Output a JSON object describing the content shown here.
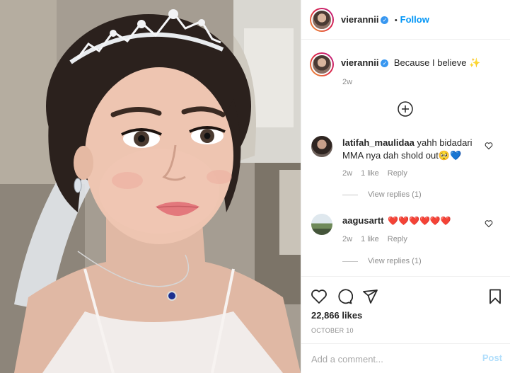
{
  "post": {
    "author": "vierannii",
    "follow_label": "Follow",
    "bullet": "•",
    "caption": "Because I believe ✨",
    "caption_age": "2w"
  },
  "comments": [
    {
      "username": "latifah_maulidaa",
      "text": "yahh bidadari MMA nya dah shold out🥺💙",
      "age": "2w",
      "likes": "1 like",
      "reply_label": "Reply",
      "view_replies": "View replies (1)"
    },
    {
      "username": "aagusartt",
      "text": "❤️❤️❤️❤️❤️❤️",
      "age": "2w",
      "likes": "1 like",
      "reply_label": "Reply",
      "view_replies": "View replies (1)"
    }
  ],
  "actions": {
    "likes_count": "22,866 likes",
    "date": "OCTOBER 10"
  },
  "comment_box": {
    "placeholder": "Add a comment...",
    "post_label": "Post"
  },
  "colors": {
    "accent": "#0095f6",
    "heart_red": "#ed4956",
    "verified": "#3897f0"
  },
  "icons": [
    "verified-badge-icon",
    "more-comments-icon",
    "heart-outline-icon",
    "comment-icon",
    "share-icon",
    "bookmark-icon"
  ]
}
